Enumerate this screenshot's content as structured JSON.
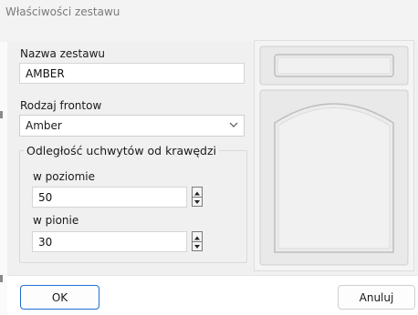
{
  "dialog": {
    "title": "Właściwości zestawu"
  },
  "form": {
    "set_name_label": "Nazwa zestawu",
    "set_name_value": "AMBER",
    "front_type_label": "Rodzaj frontow",
    "front_type_selected": "Amber",
    "handles_group_label": "Odległość uchwytów od krawędzi",
    "horizontal_label": "w poziomie",
    "horizontal_value": "50",
    "vertical_label": "w pionie",
    "vertical_value": "30"
  },
  "icons": {
    "dropdown": "chevron-down-icon",
    "spin_up": "triangle-up-icon",
    "spin_down": "triangle-down-icon"
  },
  "buttons": {
    "ok_label": "OK",
    "cancel_label": "Anuluj"
  },
  "colors": {
    "accent": "#1f6fd1",
    "dialog_bg": "#f0f0f0",
    "preview_face": "#e9e9e9"
  }
}
